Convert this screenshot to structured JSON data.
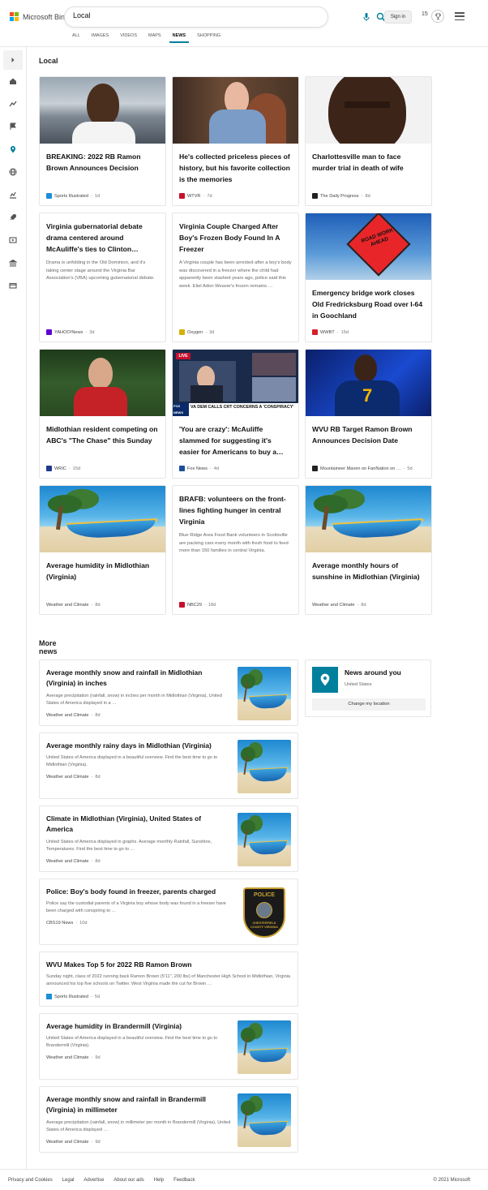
{
  "header": {
    "brand": "Microsoft Bing",
    "search_value": "Local",
    "signin_label": "Sign in",
    "reward_count": "15",
    "tabs": [
      {
        "label": "ALL"
      },
      {
        "label": "IMAGES"
      },
      {
        "label": "VIDEOS"
      },
      {
        "label": "MAPS"
      },
      {
        "label": "NEWS",
        "active": true
      },
      {
        "label": "SHOPPING"
      }
    ]
  },
  "rail": {
    "icons": [
      "chevron-right-icon",
      "home-icon",
      "trending-icon",
      "flag-icon",
      "location-icon",
      "globe-icon",
      "business-icon",
      "rocket-icon",
      "entertainment-icon",
      "bank-icon",
      "card-icon"
    ]
  },
  "top_heading": "Local",
  "top_cards": [
    {
      "title": "BREAKING: 2022 RB Ramon Brown Announces Decision",
      "snippet": "",
      "source": "Sports Illustrated",
      "age": "1d",
      "fav_color": "#1a8fd8"
    },
    {
      "title": "He's collected priceless pieces of history, but his favorite collection is the memories",
      "snippet": "",
      "source": "WTVR",
      "age": "7d",
      "fav_color": "#c8102e"
    },
    {
      "title": "Charlottesville man to face murder trial in death of wife",
      "snippet": "",
      "source": "The Daily Progress",
      "age": "8d",
      "fav_color": "#222222"
    },
    {
      "title": "Virginia gubernatorial debate drama centered around McAuliffe's ties to Clinton…",
      "snippet": "Drama is unfolding in the Old Dominion, and it's taking center stage around the Virginia Bar Association's (VBA) upcoming gubernatorial debate.",
      "source": "YAHOO!News",
      "age": "3d",
      "fav_color": "#6001d2"
    },
    {
      "title": "Virginia Couple Charged After Boy's Frozen Body Found In A Freezer",
      "snippet": "A Virginia couple has been arrested after a boy's body was discovered in a freezer where the child had apparently been stashed years ago, police said this week.  Eliel Adon Weaver's frozen remains …",
      "source": "Oxygen",
      "age": "3d",
      "fav_color": "#d4b106"
    },
    {
      "title": "Emergency bridge work closes Old Fredricksburg Road over I-64 in Goochland",
      "snippet": "",
      "source": "WWBT",
      "age": "15d",
      "fav_color": "#d6202a"
    },
    {
      "title": "Midlothian resident competing on ABC's \"The Chase\" this Sunday",
      "snippet": "",
      "source": "WRIC",
      "age": "15d",
      "fav_color": "#1f3a8a"
    },
    {
      "title": "'You are crazy': McAuliffe slammed for suggesting it's easier for Americans to buy a…",
      "snippet": "",
      "source": "Fox News",
      "age": "4d",
      "fav_color": "#1d4e9e"
    },
    {
      "title": "WVU RB Target Ramon Brown Announces Decision Date",
      "snippet": "",
      "source": "Mountaineer Maven on FanNation on …",
      "age": "5d",
      "fav_color": "#222222"
    },
    {
      "title": "Average humidity in Midlothian (Virginia)",
      "snippet": "",
      "source": "Weather and Climate",
      "age": "8d",
      "fav_color": ""
    },
    {
      "title": "BRAFB: volunteers on the front-lines fighting hunger in central Virginia",
      "snippet": "Blue Ridge Area Food Bank volunteers in Scottsville are packing cars every month with fresh food to feed more than 150 families in central Virginia.",
      "source": "NBC29",
      "age": "18d",
      "fav_color": "#c8102e"
    },
    {
      "title": "Average monthly hours of sunshine in Midlothian (Virginia)",
      "snippet": "",
      "source": "Weather and Climate",
      "age": "8d",
      "fav_color": ""
    }
  ],
  "more_heading": "More news",
  "more_news": [
    {
      "title": "Average monthly snow and rainfall in Midlothian (Virginia) in inches",
      "snippet": "Average precipitation (rainfall, snow) in inches per month in Midlothian (Virginia), United States of America displayed in a …",
      "source": "Weather and Climate",
      "age": "8d",
      "fav_color": ""
    },
    {
      "title": "Average monthly rainy days in Midlothian (Virginia)",
      "snippet": "United States of America displayed in a beautiful overview. Find the best time to go to Midlothian (Virginia).",
      "source": "Weather and Climate",
      "age": "8d",
      "fav_color": ""
    },
    {
      "title": "Climate in Midlothian (Virginia), United States of America",
      "snippet": "United States of America displayed in graphs. Average monthly Rainfall, Sunshine, Temperatures. Find the best time to go to …",
      "source": "Weather and Climate",
      "age": "8d",
      "fav_color": ""
    },
    {
      "title": "Police: Boy's body found in freezer, parents charged",
      "snippet": "Police say the custodial parents of a Virginia boy whose body was found in a freezer have been charged with conspiring to …",
      "source": "CBS19 News",
      "age": "10d",
      "fav_color": ""
    },
    {
      "title": "WVU Makes Top 5 for 2022 RB Ramon Brown",
      "snippet": "Sunday night, class of 2022 running back Ramon Brown (5'11\", 200 lbs) of Manchester High School in Midlothian, Virginia announced his top five schools on Twitter. West Virginia made the cut for Brown …",
      "source": "Sports Illustrated",
      "age": "5d",
      "fav_color": "#1a8fd8"
    },
    {
      "title": "Average humidity in Brandermill (Virginia)",
      "snippet": "United States of America displayed in a beautiful overview. Find the best time to go to Brandermill (Virginia).",
      "source": "Weather and Climate",
      "age": "9d",
      "fav_color": ""
    },
    {
      "title": "Average monthly snow and rainfall in Brandermill (Virginia) in millimeter",
      "snippet": "Average precipitation (rainfall, snow) in millimeter per month in Brandermill (Virginia), United States of America displayed …",
      "source": "Weather and Climate",
      "age": "9d",
      "fav_color": ""
    }
  ],
  "news_around": {
    "title": "News around you",
    "location": "United States",
    "button": "Change my location"
  },
  "image_text": {
    "road_sign": "ROAD WORK AHEAD",
    "fox_banner": "VA DEM CALLS CRT CONCERNS A 'CONSPIRACY'",
    "fox_logo": "FOX NEWS",
    "live": "LIVE",
    "police_badge_top": "POLICE",
    "police_badge_bottom": "CHESTERFIELD COUNTY VIRGINIA",
    "jersey_number": "7"
  },
  "footer": {
    "links": [
      "Privacy and Cookies",
      "Legal",
      "Advertise",
      "About our ads",
      "Help",
      "Feedback"
    ],
    "copyright": "© 2021 Microsoft"
  }
}
